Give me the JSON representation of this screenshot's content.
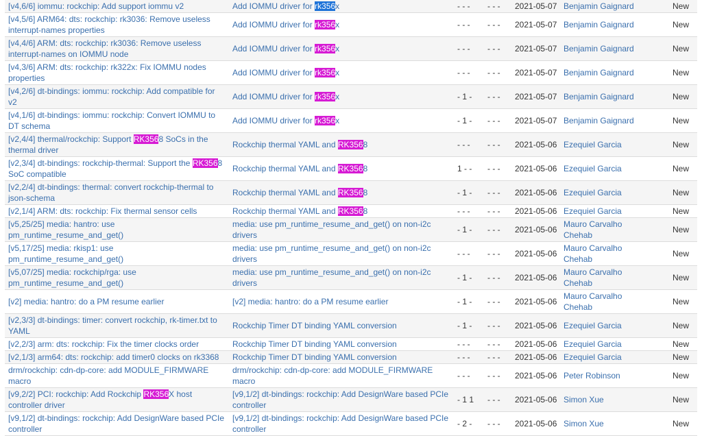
{
  "highlight_colors": {
    "selected": "#1e73d8",
    "match": "#d61bd4"
  },
  "rows": [
    {
      "name": [
        {
          "t": "[v4,6/6] iommu: rockchip: Add support iommu v2"
        }
      ],
      "series": [
        {
          "t": "Add IOMMU driver for "
        },
        {
          "t": "rk356",
          "hl": "selected"
        },
        {
          "t": "x"
        }
      ],
      "acks": "- - -",
      "reviews": "- - -",
      "date": "2021-05-07",
      "submitter": "Benjamin Gaignard",
      "state": "New"
    },
    {
      "name": [
        {
          "t": "[v4,5/6] ARM64: dts: rockchip: rk3036: Remove useless interrupt-names properties"
        }
      ],
      "series": [
        {
          "t": "Add IOMMU driver for "
        },
        {
          "t": "rk356",
          "hl": "match"
        },
        {
          "t": "x"
        }
      ],
      "acks": "- - -",
      "reviews": "- - -",
      "date": "2021-05-07",
      "submitter": "Benjamin Gaignard",
      "state": "New"
    },
    {
      "name": [
        {
          "t": "[v4,4/6] ARM: dts: rockchip: rk3036: Remove useless interrupt-names on IOMMU node"
        }
      ],
      "series": [
        {
          "t": "Add IOMMU driver for "
        },
        {
          "t": "rk356",
          "hl": "match"
        },
        {
          "t": "x"
        }
      ],
      "acks": "- - -",
      "reviews": "- - -",
      "date": "2021-05-07",
      "submitter": "Benjamin Gaignard",
      "state": "New"
    },
    {
      "name": [
        {
          "t": "[v4,3/6] ARM: dts: rockchip: rk322x: Fix IOMMU nodes properties"
        }
      ],
      "series": [
        {
          "t": "Add IOMMU driver for "
        },
        {
          "t": "rk356",
          "hl": "match"
        },
        {
          "t": "x"
        }
      ],
      "acks": "- - -",
      "reviews": "- - -",
      "date": "2021-05-07",
      "submitter": "Benjamin Gaignard",
      "state": "New"
    },
    {
      "name": [
        {
          "t": "[v4,2/6] dt-bindings: iommu: rockchip: Add compatible for v2"
        }
      ],
      "series": [
        {
          "t": "Add IOMMU driver for "
        },
        {
          "t": "rk356",
          "hl": "match"
        },
        {
          "t": "x"
        }
      ],
      "acks": "- 1 -",
      "reviews": "- - -",
      "date": "2021-05-07",
      "submitter": "Benjamin Gaignard",
      "state": "New"
    },
    {
      "name": [
        {
          "t": "[v4,1/6] dt-bindings: iommu: rockchip: Convert IOMMU to DT schema"
        }
      ],
      "series": [
        {
          "t": "Add IOMMU driver for "
        },
        {
          "t": "rk356",
          "hl": "match"
        },
        {
          "t": "x"
        }
      ],
      "acks": "- 1 -",
      "reviews": "- - -",
      "date": "2021-05-07",
      "submitter": "Benjamin Gaignard",
      "state": "New"
    },
    {
      "name": [
        {
          "t": "[v2,4/4] thermal/rockchip: Support "
        },
        {
          "t": "RK356",
          "hl": "match"
        },
        {
          "t": "8 SoCs in the thermal driver"
        }
      ],
      "series": [
        {
          "t": "Rockchip thermal YAML and "
        },
        {
          "t": "RK356",
          "hl": "match"
        },
        {
          "t": "8"
        }
      ],
      "acks": "- - -",
      "reviews": "- - -",
      "date": "2021-05-06",
      "submitter": "Ezequiel Garcia",
      "state": "New"
    },
    {
      "name": [
        {
          "t": "[v2,3/4] dt-bindings: rockchip-thermal: Support the "
        },
        {
          "t": "RK356",
          "hl": "match"
        },
        {
          "t": "8 SoC compatible"
        }
      ],
      "series": [
        {
          "t": "Rockchip thermal YAML and "
        },
        {
          "t": "RK356",
          "hl": "match"
        },
        {
          "t": "8"
        }
      ],
      "acks": "1 - -",
      "reviews": "- - -",
      "date": "2021-05-06",
      "submitter": "Ezequiel Garcia",
      "state": "New"
    },
    {
      "name": [
        {
          "t": "[v2,2/4] dt-bindings: thermal: convert rockchip-thermal to json-schema"
        }
      ],
      "series": [
        {
          "t": "Rockchip thermal YAML and "
        },
        {
          "t": "RK356",
          "hl": "match"
        },
        {
          "t": "8"
        }
      ],
      "acks": "- 1 -",
      "reviews": "- - -",
      "date": "2021-05-06",
      "submitter": "Ezequiel Garcia",
      "state": "New"
    },
    {
      "name": [
        {
          "t": "[v2,1/4] ARM: dts: rockchip: Fix thermal sensor cells"
        }
      ],
      "series": [
        {
          "t": "Rockchip thermal YAML and "
        },
        {
          "t": "RK356",
          "hl": "match"
        },
        {
          "t": "8"
        }
      ],
      "acks": "- - -",
      "reviews": "- - -",
      "date": "2021-05-06",
      "submitter": "Ezequiel Garcia",
      "state": "New"
    },
    {
      "name": [
        {
          "t": "[v5,25/25] media: hantro: use pm_runtime_resume_and_get()"
        }
      ],
      "series": [
        {
          "t": "media: use pm_runtime_resume_and_get() on non-i2c drivers"
        }
      ],
      "acks": "- 1 -",
      "reviews": "- - -",
      "date": "2021-05-06",
      "submitter": "Mauro Carvalho Chehab",
      "state": "New"
    },
    {
      "name": [
        {
          "t": "[v5,17/25] media: rkisp1: use pm_runtime_resume_and_get()"
        }
      ],
      "series": [
        {
          "t": "media: use pm_runtime_resume_and_get() on non-i2c drivers"
        }
      ],
      "acks": "- - -",
      "reviews": "- - -",
      "date": "2021-05-06",
      "submitter": "Mauro Carvalho Chehab",
      "state": "New"
    },
    {
      "name": [
        {
          "t": "[v5,07/25] media: rockchip/rga: use pm_runtime_resume_and_get()"
        }
      ],
      "series": [
        {
          "t": "media: use pm_runtime_resume_and_get() on non-i2c drivers"
        }
      ],
      "acks": "- 1 -",
      "reviews": "- - -",
      "date": "2021-05-06",
      "submitter": "Mauro Carvalho Chehab",
      "state": "New"
    },
    {
      "name": [
        {
          "t": "[v2] media: hantro: do a PM resume earlier"
        }
      ],
      "series": [
        {
          "t": "[v2] media: hantro: do a PM resume earlier"
        }
      ],
      "acks": "- 1 -",
      "reviews": "- - -",
      "date": "2021-05-06",
      "submitter": "Mauro Carvalho Chehab",
      "state": "New"
    },
    {
      "name": [
        {
          "t": "[v2,3/3] dt-bindings: timer: convert rockchip, rk-timer.txt to YAML"
        }
      ],
      "series": [
        {
          "t": "Rockchip Timer DT binding YAML conversion"
        }
      ],
      "acks": "- 1 -",
      "reviews": "- - -",
      "date": "2021-05-06",
      "submitter": "Ezequiel Garcia",
      "state": "New"
    },
    {
      "name": [
        {
          "t": "[v2,2/3] arm: dts: rockchip: Fix the timer clocks order"
        }
      ],
      "series": [
        {
          "t": "Rockchip Timer DT binding YAML conversion"
        }
      ],
      "acks": "- - -",
      "reviews": "- - -",
      "date": "2021-05-06",
      "submitter": "Ezequiel Garcia",
      "state": "New"
    },
    {
      "name": [
        {
          "t": "[v2,1/3] arm64: dts: rockchip: add timer0 clocks on rk3368"
        }
      ],
      "series": [
        {
          "t": "Rockchip Timer DT binding YAML conversion"
        }
      ],
      "acks": "- - -",
      "reviews": "- - -",
      "date": "2021-05-06",
      "submitter": "Ezequiel Garcia",
      "state": "New"
    },
    {
      "name": [
        {
          "t": "drm/rockchip: cdn-dp-core: add MODULE_FIRMWARE macro"
        }
      ],
      "series": [
        {
          "t": "drm/rockchip: cdn-dp-core: add MODULE_FIRMWARE macro"
        }
      ],
      "acks": "- - -",
      "reviews": "- - -",
      "date": "2021-05-06",
      "submitter": "Peter Robinson",
      "state": "New"
    },
    {
      "name": [
        {
          "t": "[v9,2/2] PCI: rockchip: Add Rockchip "
        },
        {
          "t": "RK356",
          "hl": "match"
        },
        {
          "t": "X host controller driver"
        }
      ],
      "series": [
        {
          "t": "[v9,1/2] dt-bindings: rockchip: Add DesignWare based PCIe controller"
        }
      ],
      "acks": "- 1 1",
      "reviews": "- - -",
      "date": "2021-05-06",
      "submitter": "Simon Xue",
      "state": "New"
    },
    {
      "name": [
        {
          "t": "[v9,1/2] dt-bindings: rockchip: Add DesignWare based PCIe controller"
        }
      ],
      "series": [
        {
          "t": "[v9,1/2] dt-bindings: rockchip: Add DesignWare based PCIe controller"
        }
      ],
      "acks": "- 2 -",
      "reviews": "- - -",
      "date": "2021-05-06",
      "submitter": "Simon Xue",
      "state": "New"
    }
  ]
}
